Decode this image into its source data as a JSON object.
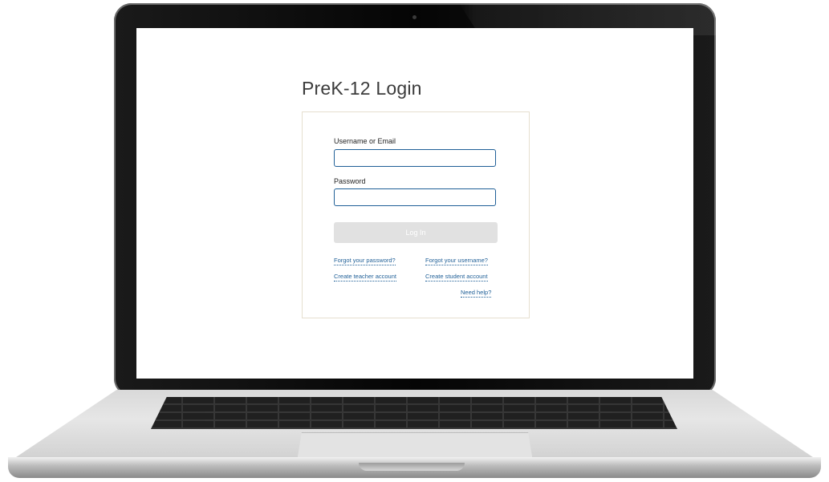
{
  "page": {
    "title": "PreK-12 Login"
  },
  "login_form": {
    "username_label": "Username or Email",
    "username_value": "",
    "password_label": "Password",
    "password_value": "",
    "login_button_label": "Log In"
  },
  "links": {
    "forgot_password": "Forgot your password?",
    "forgot_username": "Forgot your username?",
    "create_teacher": "Create teacher account",
    "create_student": "Create student account",
    "need_help": "Need help?"
  },
  "colors": {
    "link": "#1f5f97",
    "input_border": "#1f5f97",
    "button_disabled": "#e1e1e1"
  }
}
